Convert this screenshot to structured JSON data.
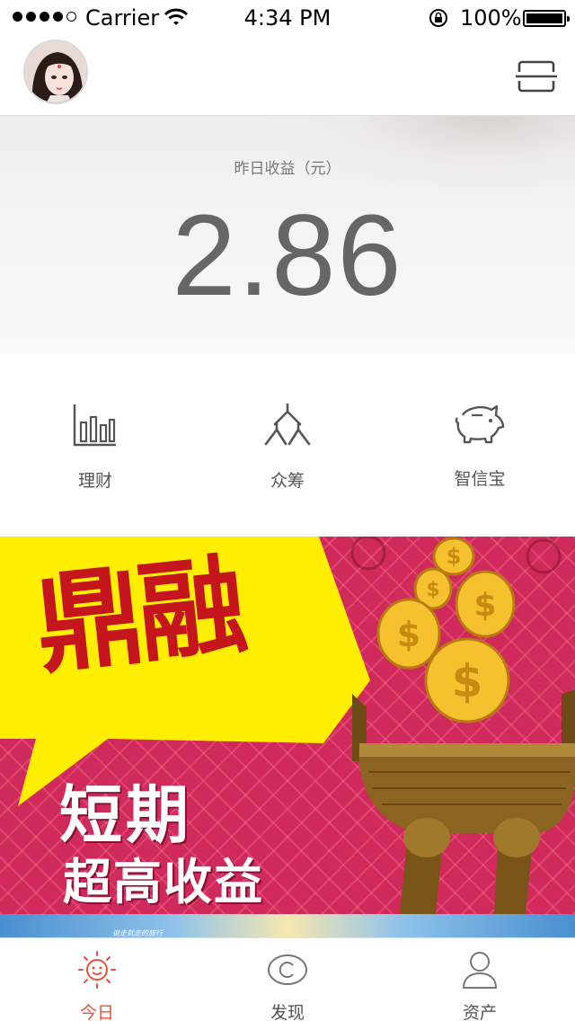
{
  "status_bar": {
    "carrier": "Carrier",
    "time": "4:34 PM",
    "battery": "100%",
    "signal_bars": 4
  },
  "header": {
    "avatar_icon": "user-avatar",
    "scan_icon": "scan-icon"
  },
  "earnings": {
    "label": "昨日收益（元）",
    "value": "2.86"
  },
  "menu": [
    {
      "label": "理财",
      "icon": "bar-chart-icon"
    },
    {
      "label": "众筹",
      "icon": "crowd-icon"
    },
    {
      "label": "智信宝",
      "icon": "piggy-bank-icon"
    }
  ],
  "banner": {
    "title": "鼎融",
    "line1": "短期",
    "line2": "超高收益",
    "strip_text": "说走就走的旅行"
  },
  "tabbar": [
    {
      "label": "今日",
      "icon": "sun-icon",
      "active": true
    },
    {
      "label": "发现",
      "icon": "copyright-icon",
      "active": false
    },
    {
      "label": "资产",
      "icon": "person-icon",
      "active": false
    }
  ],
  "colors": {
    "accent": "#e8503a",
    "banner_bg": "#d02a5c",
    "banner_yellow": "#ffee00",
    "banner_red_text": "#c4161c"
  }
}
